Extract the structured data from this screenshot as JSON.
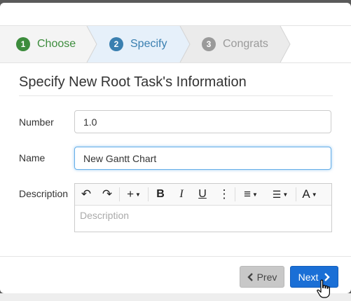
{
  "wizard": {
    "steps": [
      {
        "num": "1",
        "label": "Choose"
      },
      {
        "num": "2",
        "label": "Specify"
      },
      {
        "num": "3",
        "label": "Congrats"
      }
    ]
  },
  "form": {
    "title": "Specify New Root Task's Information",
    "number_label": "Number",
    "number_value": "1.0",
    "name_label": "Name",
    "name_value": "New Gantt Chart",
    "description_label": "Description",
    "description_placeholder": "Description"
  },
  "toolbar": {
    "undo": "↶",
    "redo": "↷",
    "insert": "+",
    "bold": "B",
    "italic": "I",
    "underline": "U",
    "more": "⋮",
    "align": "≡",
    "list": "☰",
    "font": "A"
  },
  "buttons": {
    "prev": "Prev",
    "next": "Next"
  },
  "colors": {
    "done": "#3c8c3c",
    "active": "#3a7fb0",
    "pending": "#9a9a9a",
    "primary": "#1a6fd6"
  }
}
